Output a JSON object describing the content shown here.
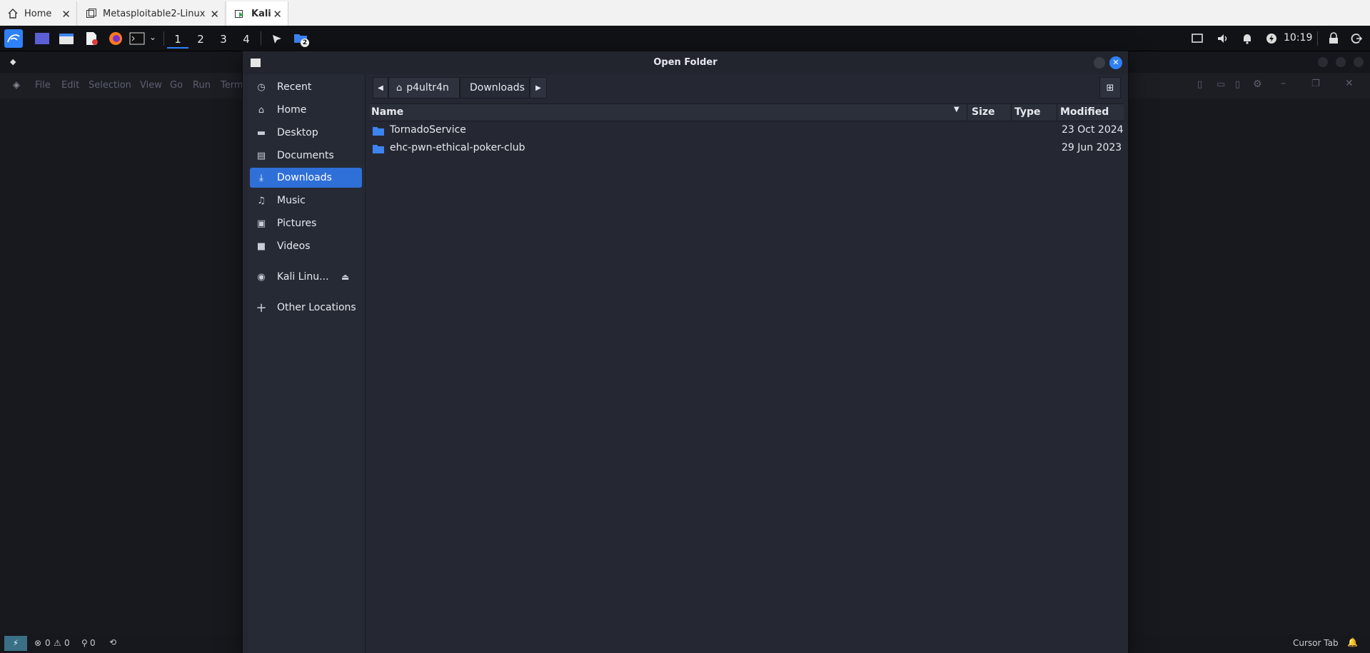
{
  "vm_tabs": [
    {
      "label": "Home",
      "close": "✕"
    },
    {
      "label": "Metasploitable2-Linux",
      "close": "✕"
    },
    {
      "label": "Kali",
      "close": "✕"
    }
  ],
  "panel": {
    "workspaces": [
      "1",
      "2",
      "3",
      "4"
    ],
    "active_workspace": "1",
    "folder_badge": "2",
    "clock": "10:19"
  },
  "editor": {
    "menu": [
      "File",
      "Edit",
      "Selection",
      "View",
      "Go",
      "Run",
      "Term"
    ],
    "status": {
      "errors": "0",
      "warnings": "0",
      "ports": "0",
      "cursor_tab": "Cursor Tab"
    }
  },
  "dialog": {
    "title": "Open Folder",
    "sidebar": [
      {
        "label": "Recent",
        "icon": "clock-icon"
      },
      {
        "label": "Home",
        "icon": "home-icon"
      },
      {
        "label": "Desktop",
        "icon": "desktop-icon"
      },
      {
        "label": "Documents",
        "icon": "document-icon"
      },
      {
        "label": "Downloads",
        "icon": "download-icon"
      },
      {
        "label": "Music",
        "icon": "music-icon"
      },
      {
        "label": "Pictures",
        "icon": "picture-icon"
      },
      {
        "label": "Videos",
        "icon": "video-icon"
      },
      {
        "label": "Kali Linu...",
        "icon": "disc-icon"
      },
      {
        "label": "Other Locations",
        "icon": "plus-icon"
      }
    ],
    "selected_sidebar": "Downloads",
    "path": [
      "p4ultr4n",
      "Downloads"
    ],
    "columns": [
      "Name",
      "Size",
      "Type",
      "Modified"
    ],
    "rows": [
      {
        "name": "TornadoService",
        "size": "",
        "type": "",
        "modified": "23 Oct 2024"
      },
      {
        "name": "ehc-pwn-ethical-poker-club",
        "size": "",
        "type": "",
        "modified": "29 Jun 2023"
      }
    ]
  },
  "colors": {
    "accent": "#2f6fd8",
    "folder": "#3d84f0",
    "dialog_bg": "#252833"
  }
}
